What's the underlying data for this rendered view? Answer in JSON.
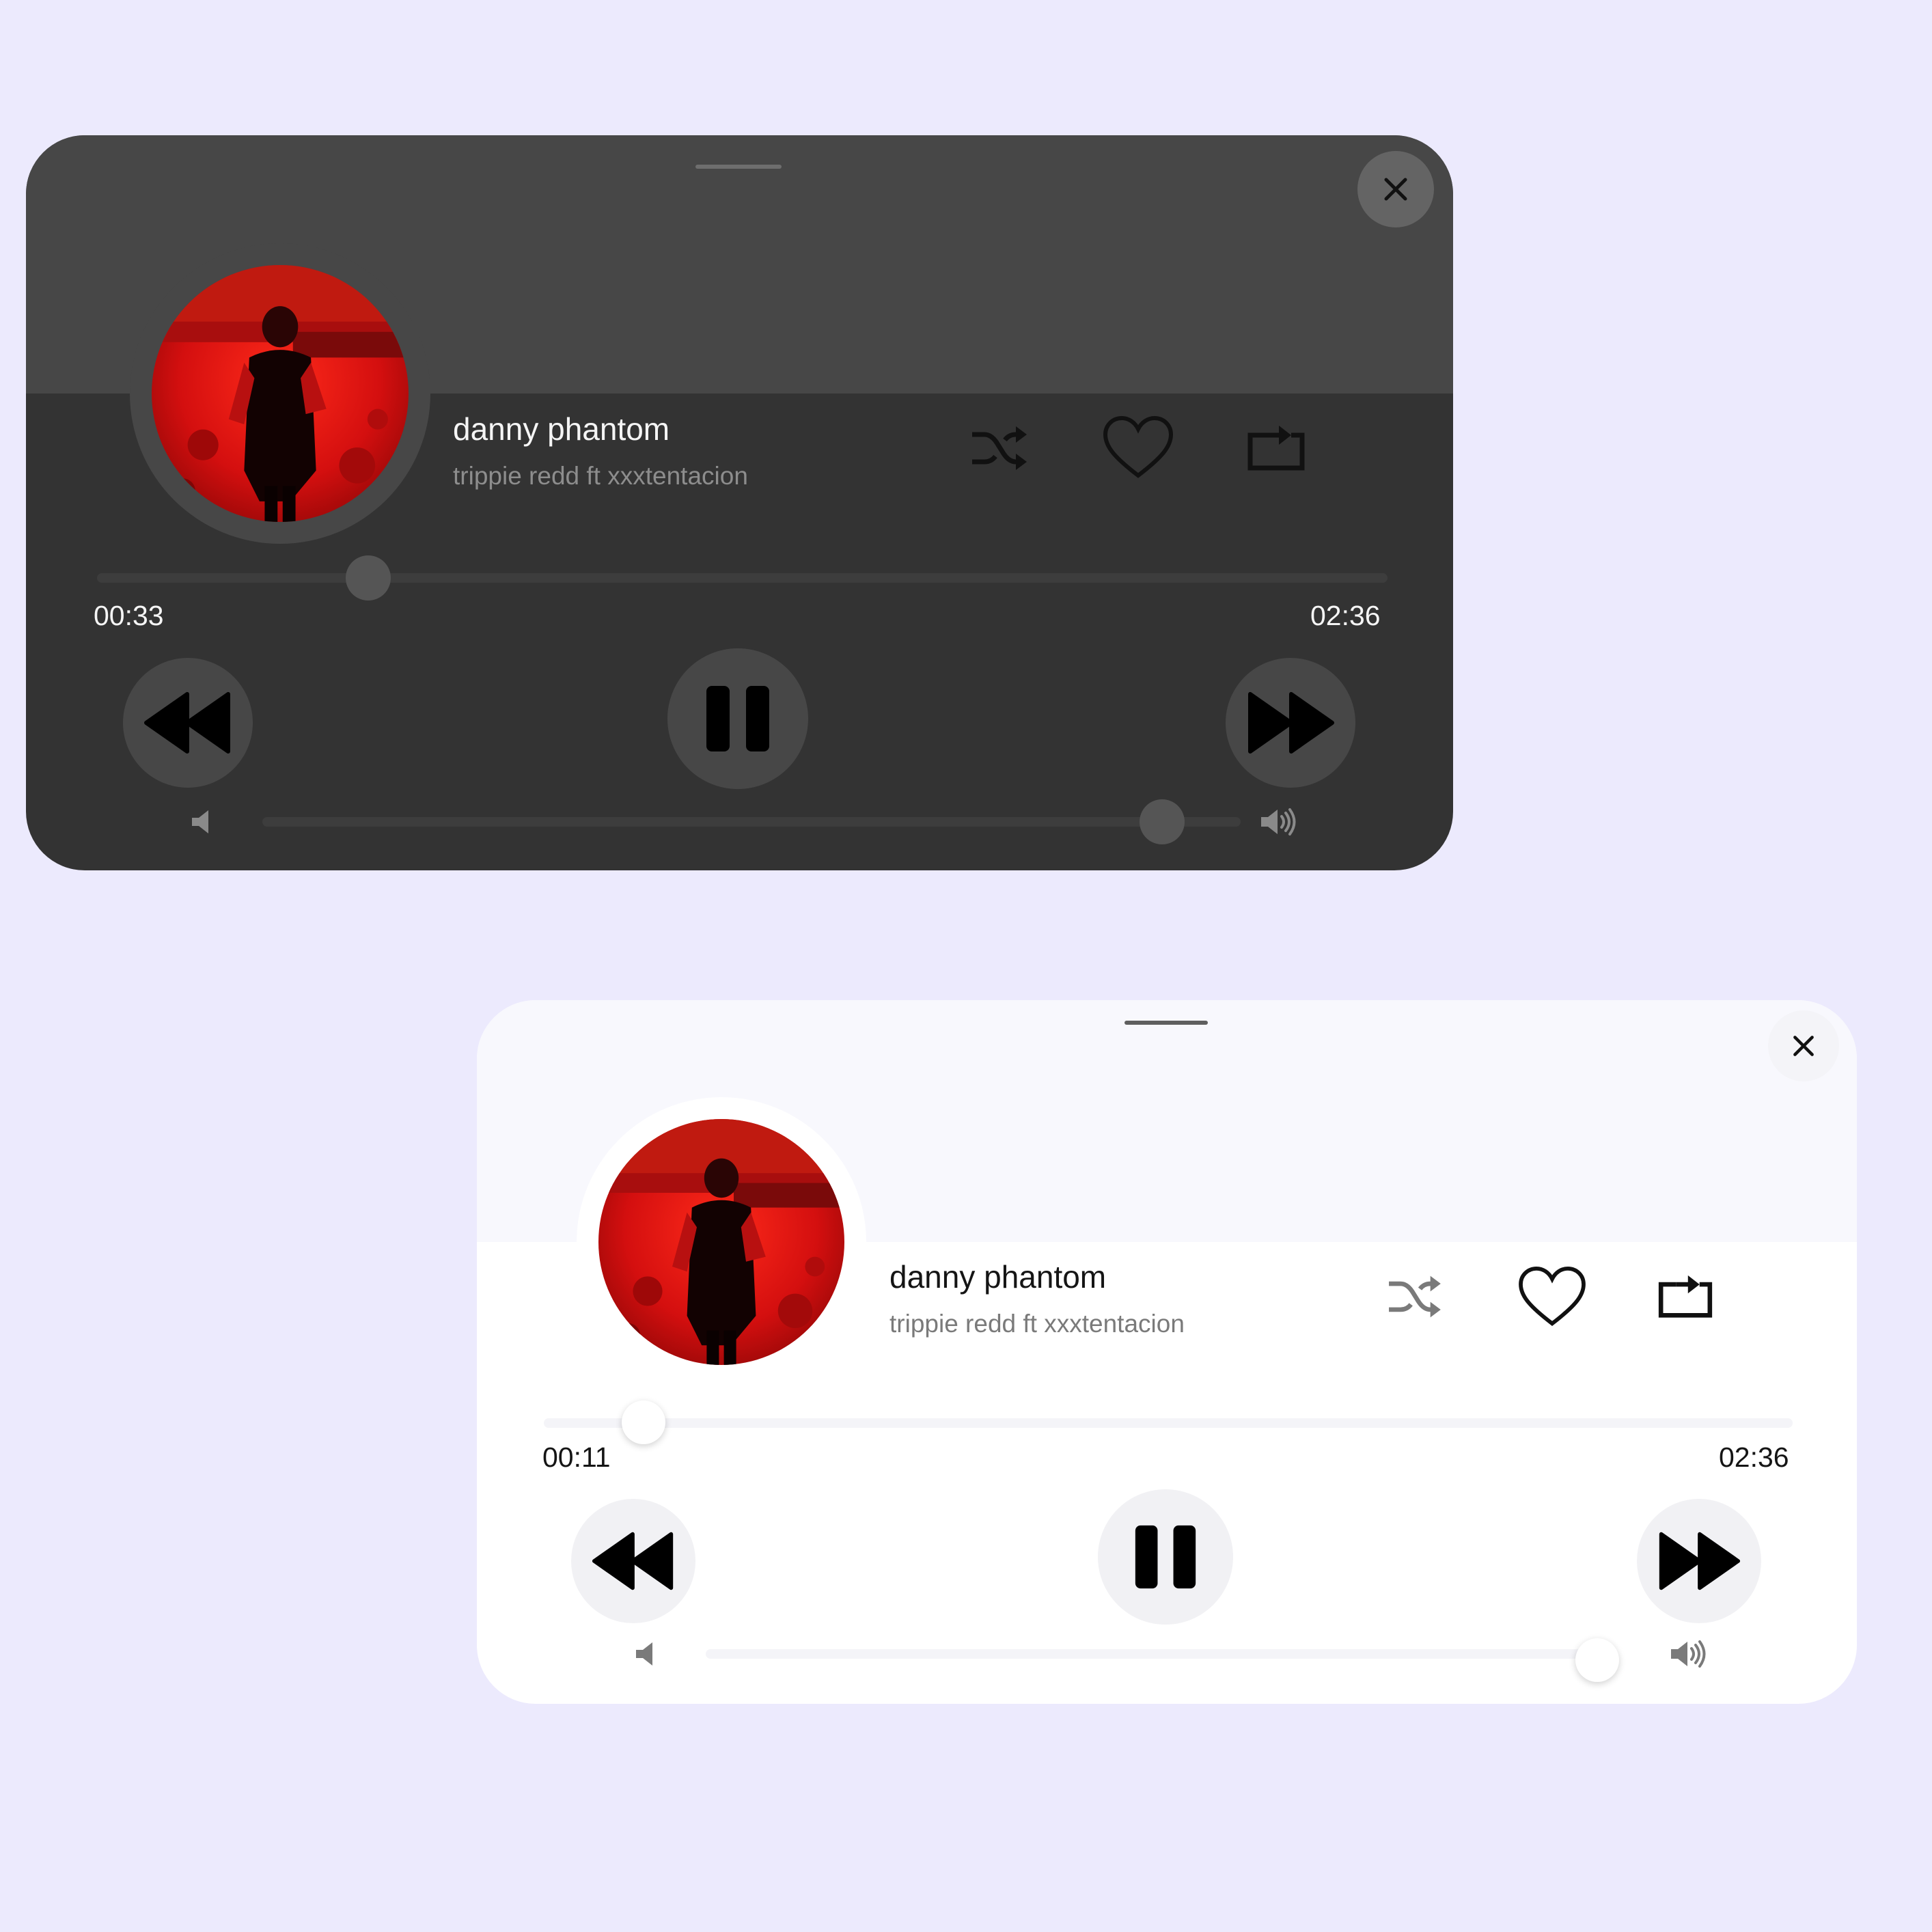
{
  "players": [
    {
      "theme": "dark",
      "song_title": "danny phantom",
      "artist": "trippie redd ft xxxtentacion",
      "elapsed": "00:33",
      "duration": "02:36",
      "progress_fraction": 0.21,
      "volume_fraction": 0.92,
      "is_playing": true,
      "icons": {
        "close": "close-icon",
        "shuffle": "shuffle-icon",
        "favorite": "heart-icon",
        "repeat": "repeat-icon",
        "previous": "rewind-icon",
        "pause": "pause-icon",
        "next": "fast-forward-icon",
        "volume_low": "volume-low-icon",
        "volume_high": "volume-high-icon"
      }
    },
    {
      "theme": "light",
      "song_title": "danny phantom",
      "artist": "trippie redd ft xxxtentacion",
      "elapsed": "00:11",
      "duration": "02:36",
      "progress_fraction": 0.08,
      "volume_fraction": 0.99,
      "is_playing": true,
      "icons": {
        "close": "close-icon",
        "shuffle": "shuffle-icon",
        "favorite": "heart-icon",
        "repeat": "repeat-icon",
        "previous": "rewind-icon",
        "pause": "pause-icon",
        "next": "fast-forward-icon",
        "volume_low": "volume-low-icon",
        "volume_high": "volume-high-icon"
      }
    }
  ],
  "colors": {
    "page_background": "#ECEAFD",
    "dark_card": "#333333",
    "dark_header": "#474747",
    "light_card": "#FFFFFF",
    "light_header": "#F8F8FD",
    "album_art_red": "#E01010"
  }
}
